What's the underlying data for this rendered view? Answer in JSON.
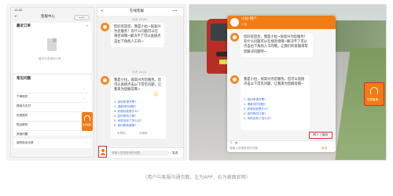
{
  "phone1": {
    "status_time": "12:00",
    "title": "客服中心",
    "menu_dots": "•••",
    "order_label": "最近订单",
    "order_more": ">",
    "empty_text": "暂无可咨询的订单",
    "faq_title": "常见问题",
    "faq_items": [
      "下单相关",
      "费用与支付",
      "优惠相关",
      "售后服务",
      "其他问题"
    ],
    "complaint_label": "我的投诉记录",
    "float_service_label": "在线客服"
  },
  "phone2": {
    "back": "<",
    "title": "在线客服",
    "dots": "•••",
    "time1": "今天 10:20",
    "greeting": "您好欢迎您，我是小拉~很高兴为您服务！有什么问题可以在线咨询哦~解决不了可以直接点击左下角找人工的~",
    "time2": "今天 10:21",
    "faq_intro": "我是小拉，很高兴为您服务。您可以直接点击以下常见问题，让我来为您解答哦~",
    "emoji": "☺",
    "links": [
      "1. 如何申请开票?",
      "2. 退款何时到账?",
      "3. 收费标准是什么?",
      "4. 如何修改订单?",
      "5. 司机迟到了怎么办?",
      "6. 如何联系客服?"
    ],
    "helpful_yes": "有帮助",
    "helpful_no": "没帮助",
    "input_placeholder": "请输入您想咨询的问题",
    "send_label": "发送"
  },
  "desktop": {
    "header_name": "小拉-用户",
    "header_sub": "小拉",
    "greeting": "您好欢迎您，我是小拉~很高兴为您服务！有什么问题可以在线咨询哦~解决不了可以点击右下角找人工的哦，让我们的客服来帮您解决问题吧~",
    "faq_intro": "我是小拉，很高兴为您服务。您可以直接点击以下常见问题，让我来为您解答哦~",
    "links": [
      "1. 如何申请开票?",
      "2. 退款何时到账?",
      "3. 收费标准是什么?",
      "4. 如何修改订单?",
      "5. 司机迟到了怎么办?"
    ],
    "human_button": "转人工服务",
    "input_placeholder": "请输入您想咨询的问题",
    "send_label": "发送",
    "side_service_label": "在线客服"
  },
  "caption": "（用户与客服沟通页面，左为APP，右为桌面官网）",
  "colors": {
    "orange": "#f07c14",
    "red": "#e3262c",
    "link_blue": "#3a6fd8"
  }
}
